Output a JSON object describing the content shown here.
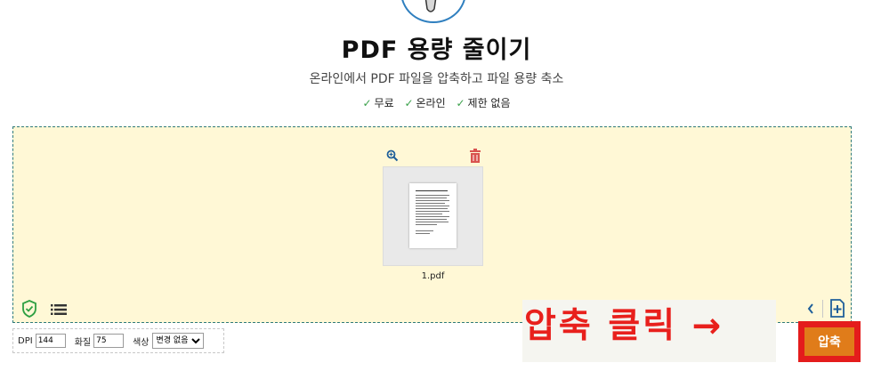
{
  "header": {
    "title": "PDF 용량 줄이기",
    "subtitle": "온라인에서 PDF 파일을 압축하고 파일 용량 축소",
    "features": [
      "무료",
      "온라인",
      "제한 없음"
    ]
  },
  "file": {
    "name": "1.pdf"
  },
  "options": {
    "dpi_label": "DPI",
    "dpi_value": "144",
    "quality_label": "화질",
    "quality_value": "75",
    "color_label": "색상",
    "color_value": "변경 없음"
  },
  "annotation": {
    "text": "압축 클릭 →"
  },
  "actions": {
    "compress_label": "압축"
  },
  "colors": {
    "accent": "#e07c1a",
    "dropzone_bg": "#fff8d6",
    "annotation_red": "#e8201c",
    "check_green": "#3aa14a",
    "brand_blue": "#2f7fbf"
  },
  "icons": {
    "logo": "pdf-compress-logo-icon",
    "zoom": "zoom-in-icon",
    "delete": "trash-icon",
    "shield": "shield-check-icon",
    "list": "list-icon",
    "prev": "chevron-left-icon",
    "add": "add-file-icon"
  }
}
